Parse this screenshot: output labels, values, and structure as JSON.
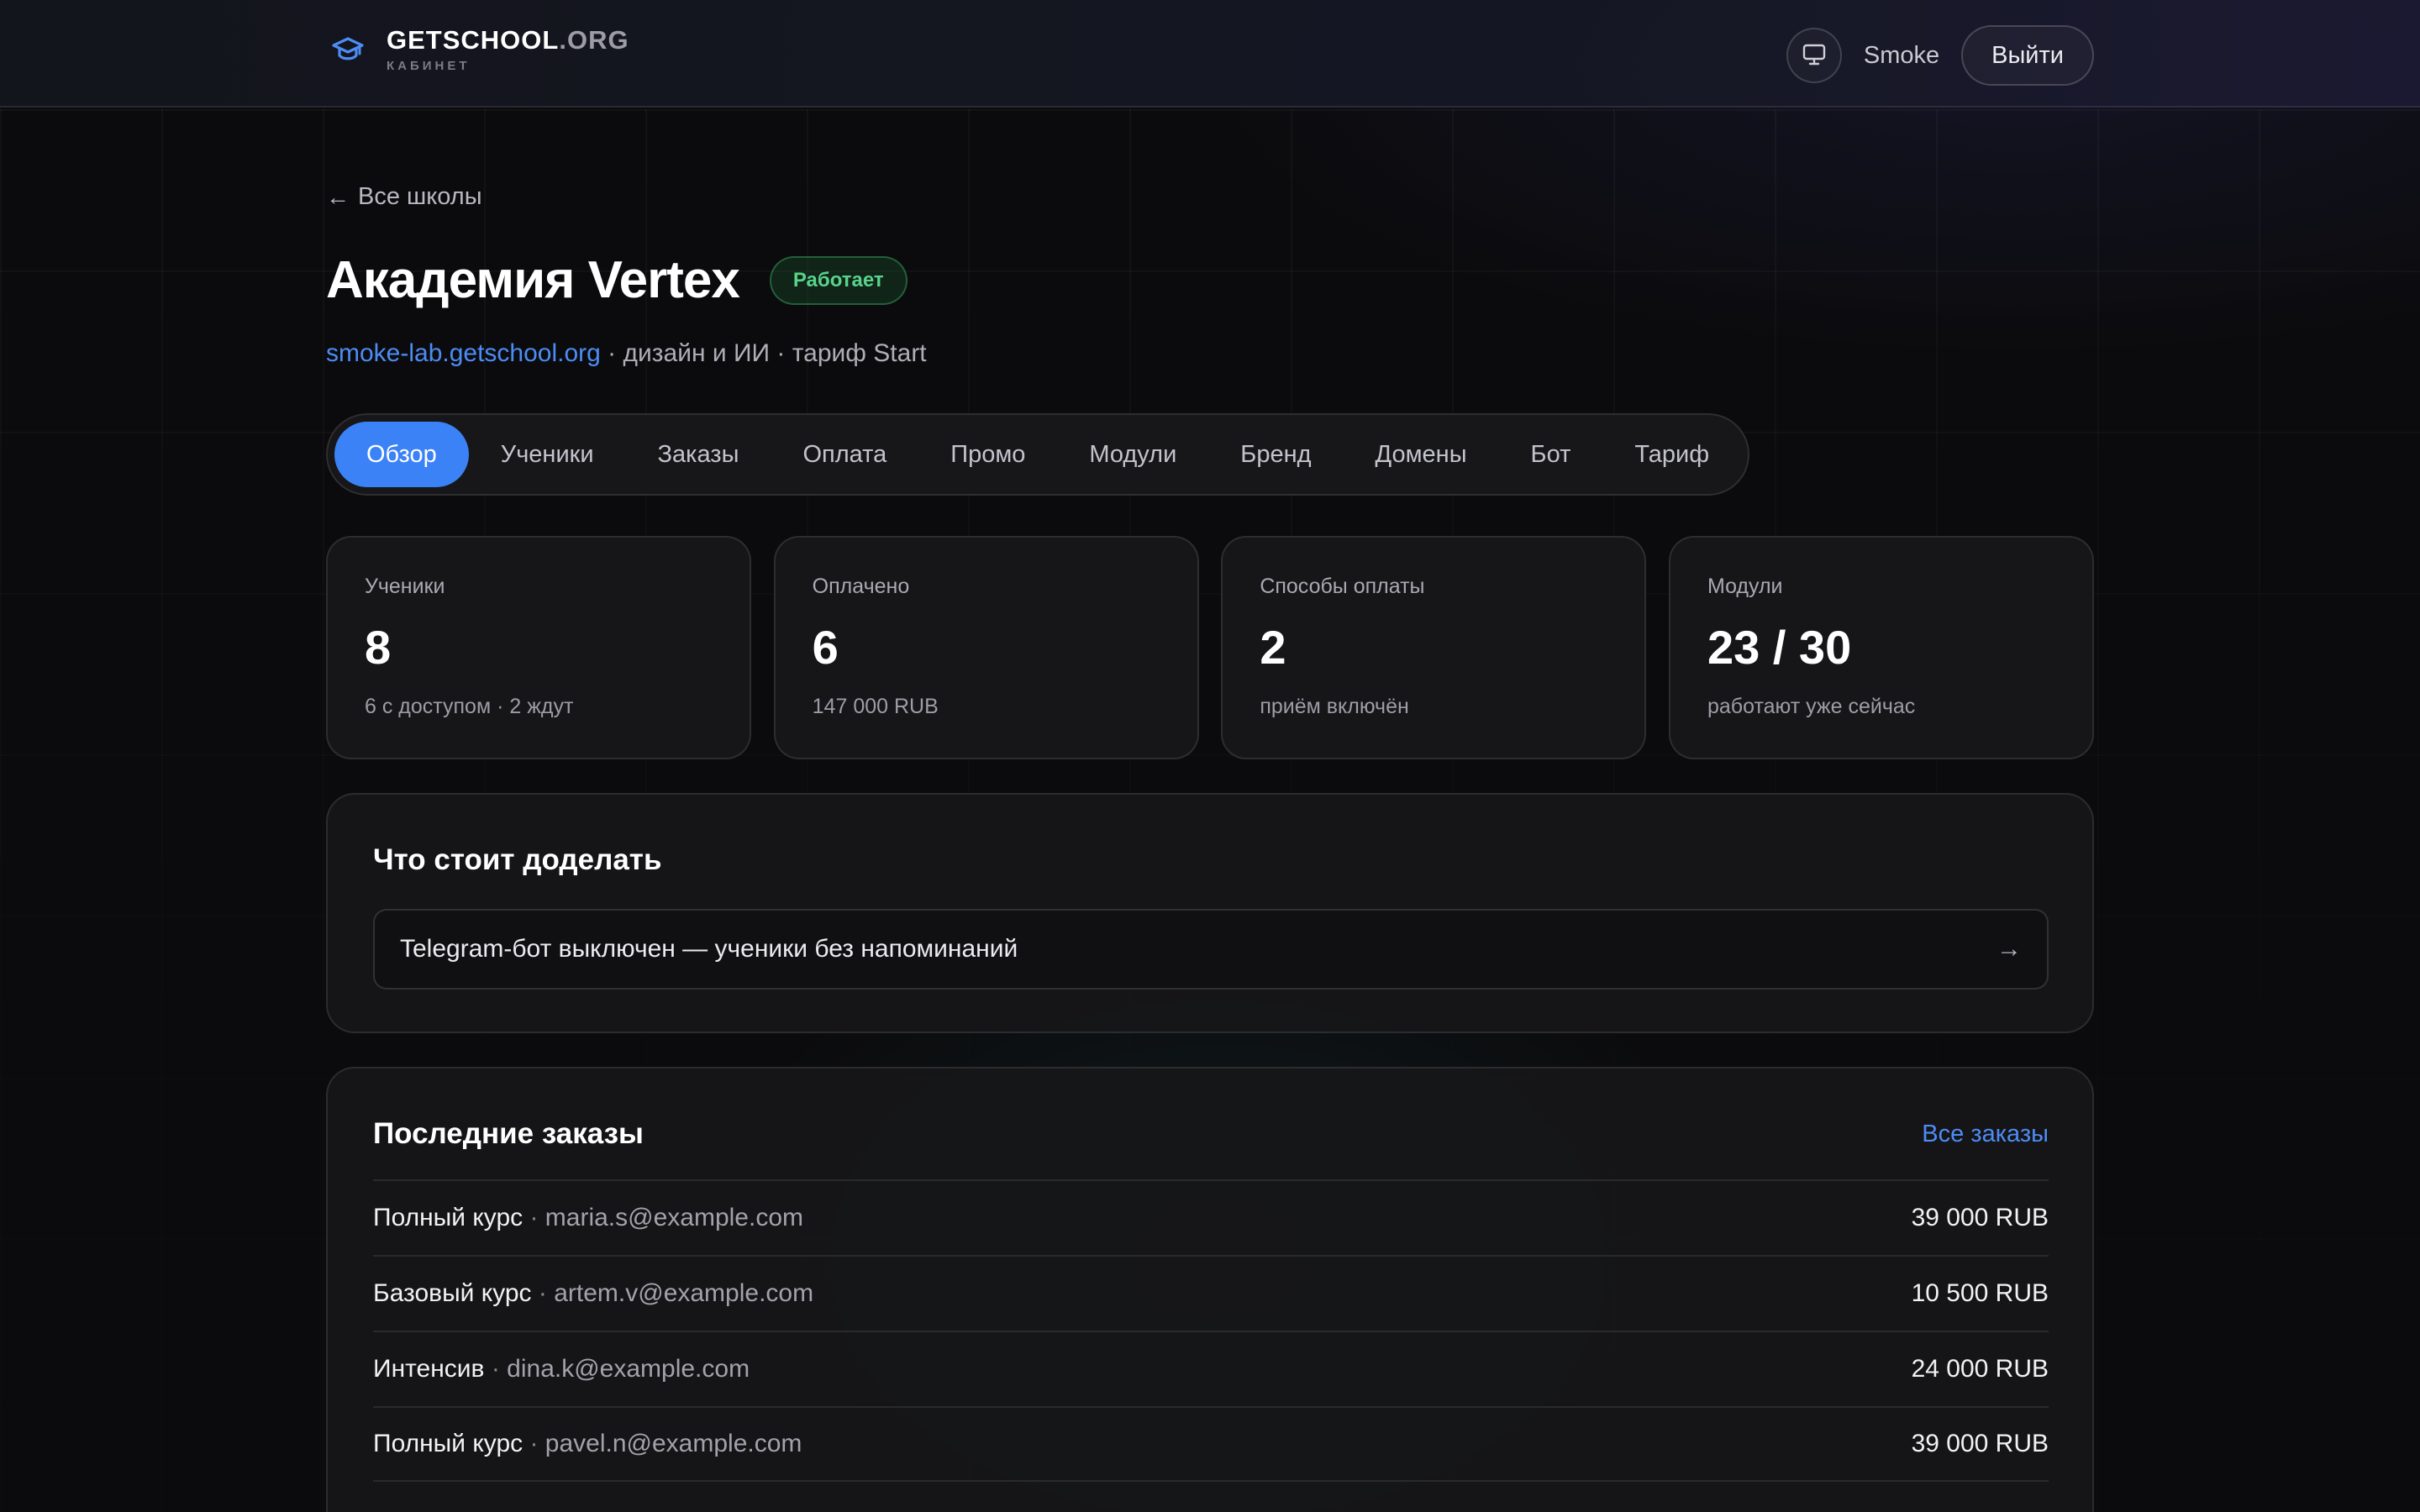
{
  "header": {
    "brand_name": "GETSCHOOL",
    "brand_tld": ".ORG",
    "brand_sub": "КАБИНЕТ",
    "user_name": "Smoke",
    "logout_label": "Выйти"
  },
  "back_link": "Все школы",
  "school": {
    "title": "Академия Vertex",
    "status": "Работает",
    "domain": "smoke-lab.getschool.org",
    "meta": " · дизайн и ИИ · тариф Start"
  },
  "tabs": [
    {
      "label": "Обзор",
      "active": true
    },
    {
      "label": "Ученики"
    },
    {
      "label": "Заказы"
    },
    {
      "label": "Оплата"
    },
    {
      "label": "Промо"
    },
    {
      "label": "Модули"
    },
    {
      "label": "Бренд"
    },
    {
      "label": "Домены"
    },
    {
      "label": "Бот"
    },
    {
      "label": "Тариф"
    }
  ],
  "stats": [
    {
      "label": "Ученики",
      "value": "8",
      "sub": "6 с доступом · 2 ждут"
    },
    {
      "label": "Оплачено",
      "value": "6",
      "sub": "147 000 RUB"
    },
    {
      "label": "Способы оплаты",
      "value": "2",
      "sub": "приём включён"
    },
    {
      "label": "Модули",
      "value": "23 / 30",
      "sub": "работают уже сейчас"
    }
  ],
  "todo": {
    "title": "Что стоит доделать",
    "items": [
      {
        "text": "Telegram-бот выключен — ученики без напоминаний"
      }
    ]
  },
  "orders": {
    "title": "Последние заказы",
    "all_link": "Все заказы",
    "separator": " · ",
    "rows": [
      {
        "product": "Полный курс",
        "email": "maria.s@example.com",
        "amount": "39 000 RUB"
      },
      {
        "product": "Базовый курс",
        "email": "artem.v@example.com",
        "amount": "10 500 RUB"
      },
      {
        "product": "Интенсив",
        "email": "dina.k@example.com",
        "amount": "24 000 RUB"
      },
      {
        "product": "Полный курс",
        "email": "pavel.n@example.com",
        "amount": "39 000 RUB"
      }
    ]
  },
  "icons": {
    "brand": "graduation-cap-icon",
    "monitor": "monitor-icon",
    "back": "arrow-left-icon",
    "todo_arrow": "arrow-right-icon"
  },
  "colors": {
    "accent": "#3b82f6",
    "link": "#4d8cf5",
    "status_green": "#58d38a"
  }
}
